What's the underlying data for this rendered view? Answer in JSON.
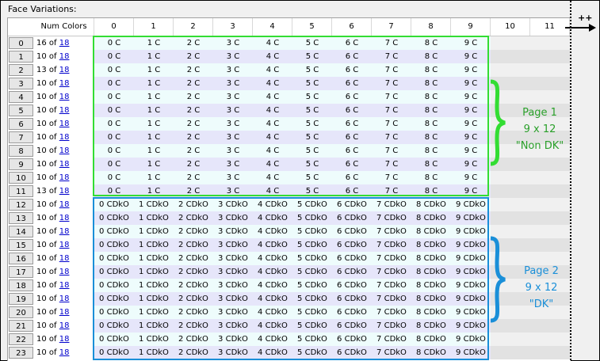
{
  "group_title": "Face Variations:",
  "header": {
    "num_colors": "Num Colors",
    "columns": [
      "0",
      "1",
      "2",
      "3",
      "4",
      "5",
      "6",
      "7",
      "8",
      "9",
      "10",
      "11"
    ]
  },
  "rows": [
    {
      "index": "0",
      "count": "16",
      "of": "of",
      "total": "18"
    },
    {
      "index": "1",
      "count": "10",
      "of": "of",
      "total": "18"
    },
    {
      "index": "2",
      "count": "13",
      "of": "of",
      "total": "18"
    },
    {
      "index": "3",
      "count": "10",
      "of": "of",
      "total": "18"
    },
    {
      "index": "4",
      "count": "10",
      "of": "of",
      "total": "18"
    },
    {
      "index": "5",
      "count": "10",
      "of": "of",
      "total": "18"
    },
    {
      "index": "6",
      "count": "10",
      "of": "of",
      "total": "18"
    },
    {
      "index": "7",
      "count": "10",
      "of": "of",
      "total": "18"
    },
    {
      "index": "8",
      "count": "10",
      "of": "of",
      "total": "18"
    },
    {
      "index": "9",
      "count": "10",
      "of": "of",
      "total": "18"
    },
    {
      "index": "10",
      "count": "10",
      "of": "of",
      "total": "18"
    },
    {
      "index": "11",
      "count": "13",
      "of": "of",
      "total": "18"
    },
    {
      "index": "12",
      "count": "10",
      "of": "of",
      "total": "18"
    },
    {
      "index": "13",
      "count": "10",
      "of": "of",
      "total": "18"
    },
    {
      "index": "14",
      "count": "10",
      "of": "of",
      "total": "18"
    },
    {
      "index": "15",
      "count": "10",
      "of": "of",
      "total": "18"
    },
    {
      "index": "16",
      "count": "10",
      "of": "of",
      "total": "18"
    },
    {
      "index": "17",
      "count": "10",
      "of": "of",
      "total": "18"
    },
    {
      "index": "18",
      "count": "10",
      "of": "of",
      "total": "18"
    },
    {
      "index": "19",
      "count": "10",
      "of": "of",
      "total": "18"
    },
    {
      "index": "20",
      "count": "10",
      "of": "of",
      "total": "18"
    },
    {
      "index": "21",
      "count": "10",
      "of": "of",
      "total": "18"
    },
    {
      "index": "22",
      "count": "10",
      "of": "of",
      "total": "18"
    },
    {
      "index": "23",
      "count": "10",
      "of": "of",
      "total": "18"
    }
  ],
  "page1_cells": [
    "0 C",
    "1 C",
    "2 C",
    "3 C",
    "4 C",
    "5 C",
    "6 C",
    "7 C",
    "8 C",
    "9 C"
  ],
  "page2_cells": [
    "0 CDkO",
    "1 CDkO",
    "2 CDkO",
    "3 CDkO",
    "4 CDkO",
    "5 CDkO",
    "6 CDkO",
    "7 CDkO",
    "8 CDkO",
    "9 CDkO"
  ],
  "scroll_marker": "++",
  "annotations": {
    "page1": {
      "line1": "Page 1",
      "line2": "9 x 12",
      "line3": "\"Non DK\"",
      "color": "#2aa02a"
    },
    "page2": {
      "line1": "Page 2",
      "line2": "9 x 12",
      "line3": "\"DK\"",
      "color": "#1a8fd8"
    }
  },
  "colors": {
    "page1_box": "#33dd33",
    "page2_box": "#1a8fd8",
    "link": "#0000cc",
    "cell_odd": "#eefcfc",
    "cell_even": "#e6e6fa"
  },
  "icons": [
    "right-arrow-icon",
    "curly-brace-icon"
  ]
}
